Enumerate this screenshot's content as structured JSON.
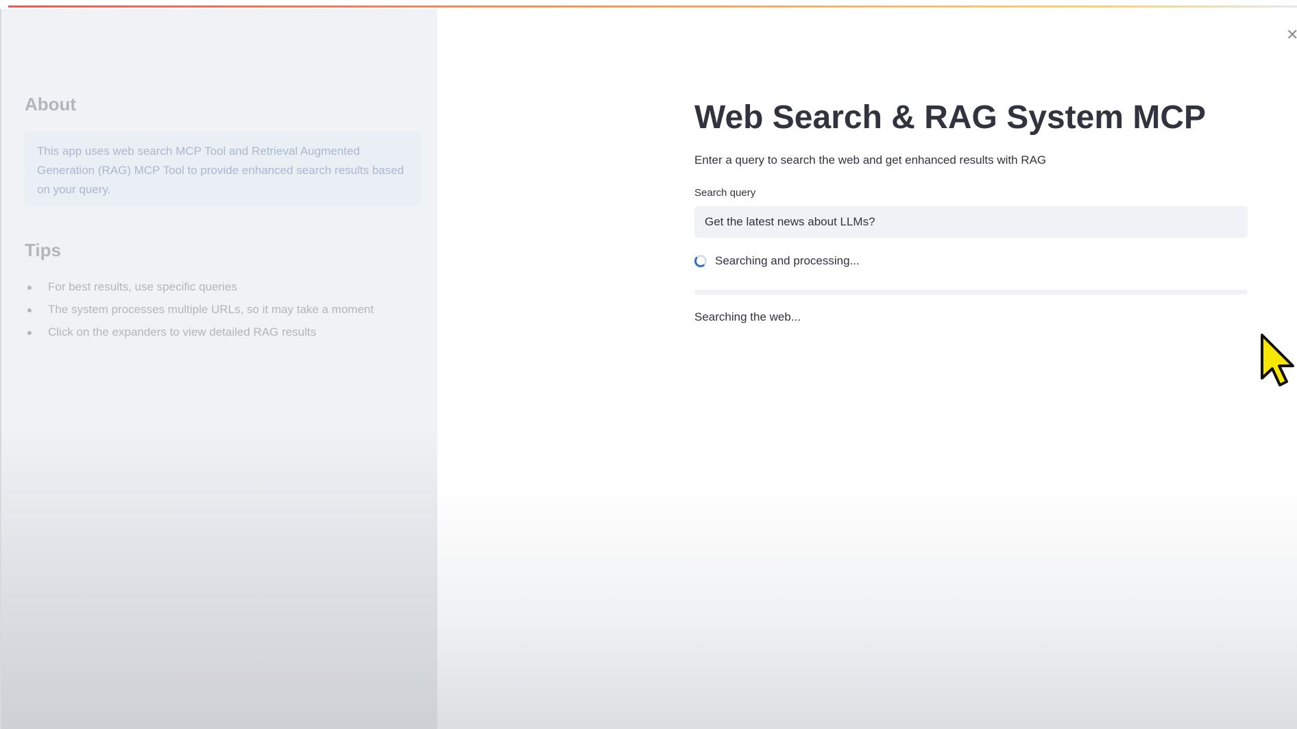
{
  "sidebar": {
    "about_heading": "About",
    "about_text": "This app uses web search MCP Tool and Retrieval Augmented Generation (RAG) MCP Tool to provide enhanced search results based on your query.",
    "tips_heading": "Tips",
    "tips": [
      "For best results, use specific queries",
      "The system processes multiple URLs, so it may take a moment",
      "Click on the expanders to view detailed RAG results"
    ]
  },
  "main": {
    "title": "Web Search & RAG System MCP",
    "subtitle": "Enter a query to search the web and get enhanced results with RAG",
    "query_label": "Search query",
    "query_value": "Get the latest news about LLMs?",
    "spinner_text": "Searching and processing...",
    "progress_fraction": 0.0,
    "status_text": "Searching the web..."
  },
  "icons": {
    "close": "close-icon",
    "spinner": "spinner-icon",
    "cursor": "mouse-cursor-icon"
  },
  "colors": {
    "sidebar_bg": "#f0f2f6",
    "text": "#31333f",
    "input_bg": "#f0f2f6",
    "info_box_bg": "#dbe4f2",
    "spinner_accent": "#2f6fce",
    "progress_fill": "#ff4b4b",
    "cursor_fill": "#f6e600"
  }
}
